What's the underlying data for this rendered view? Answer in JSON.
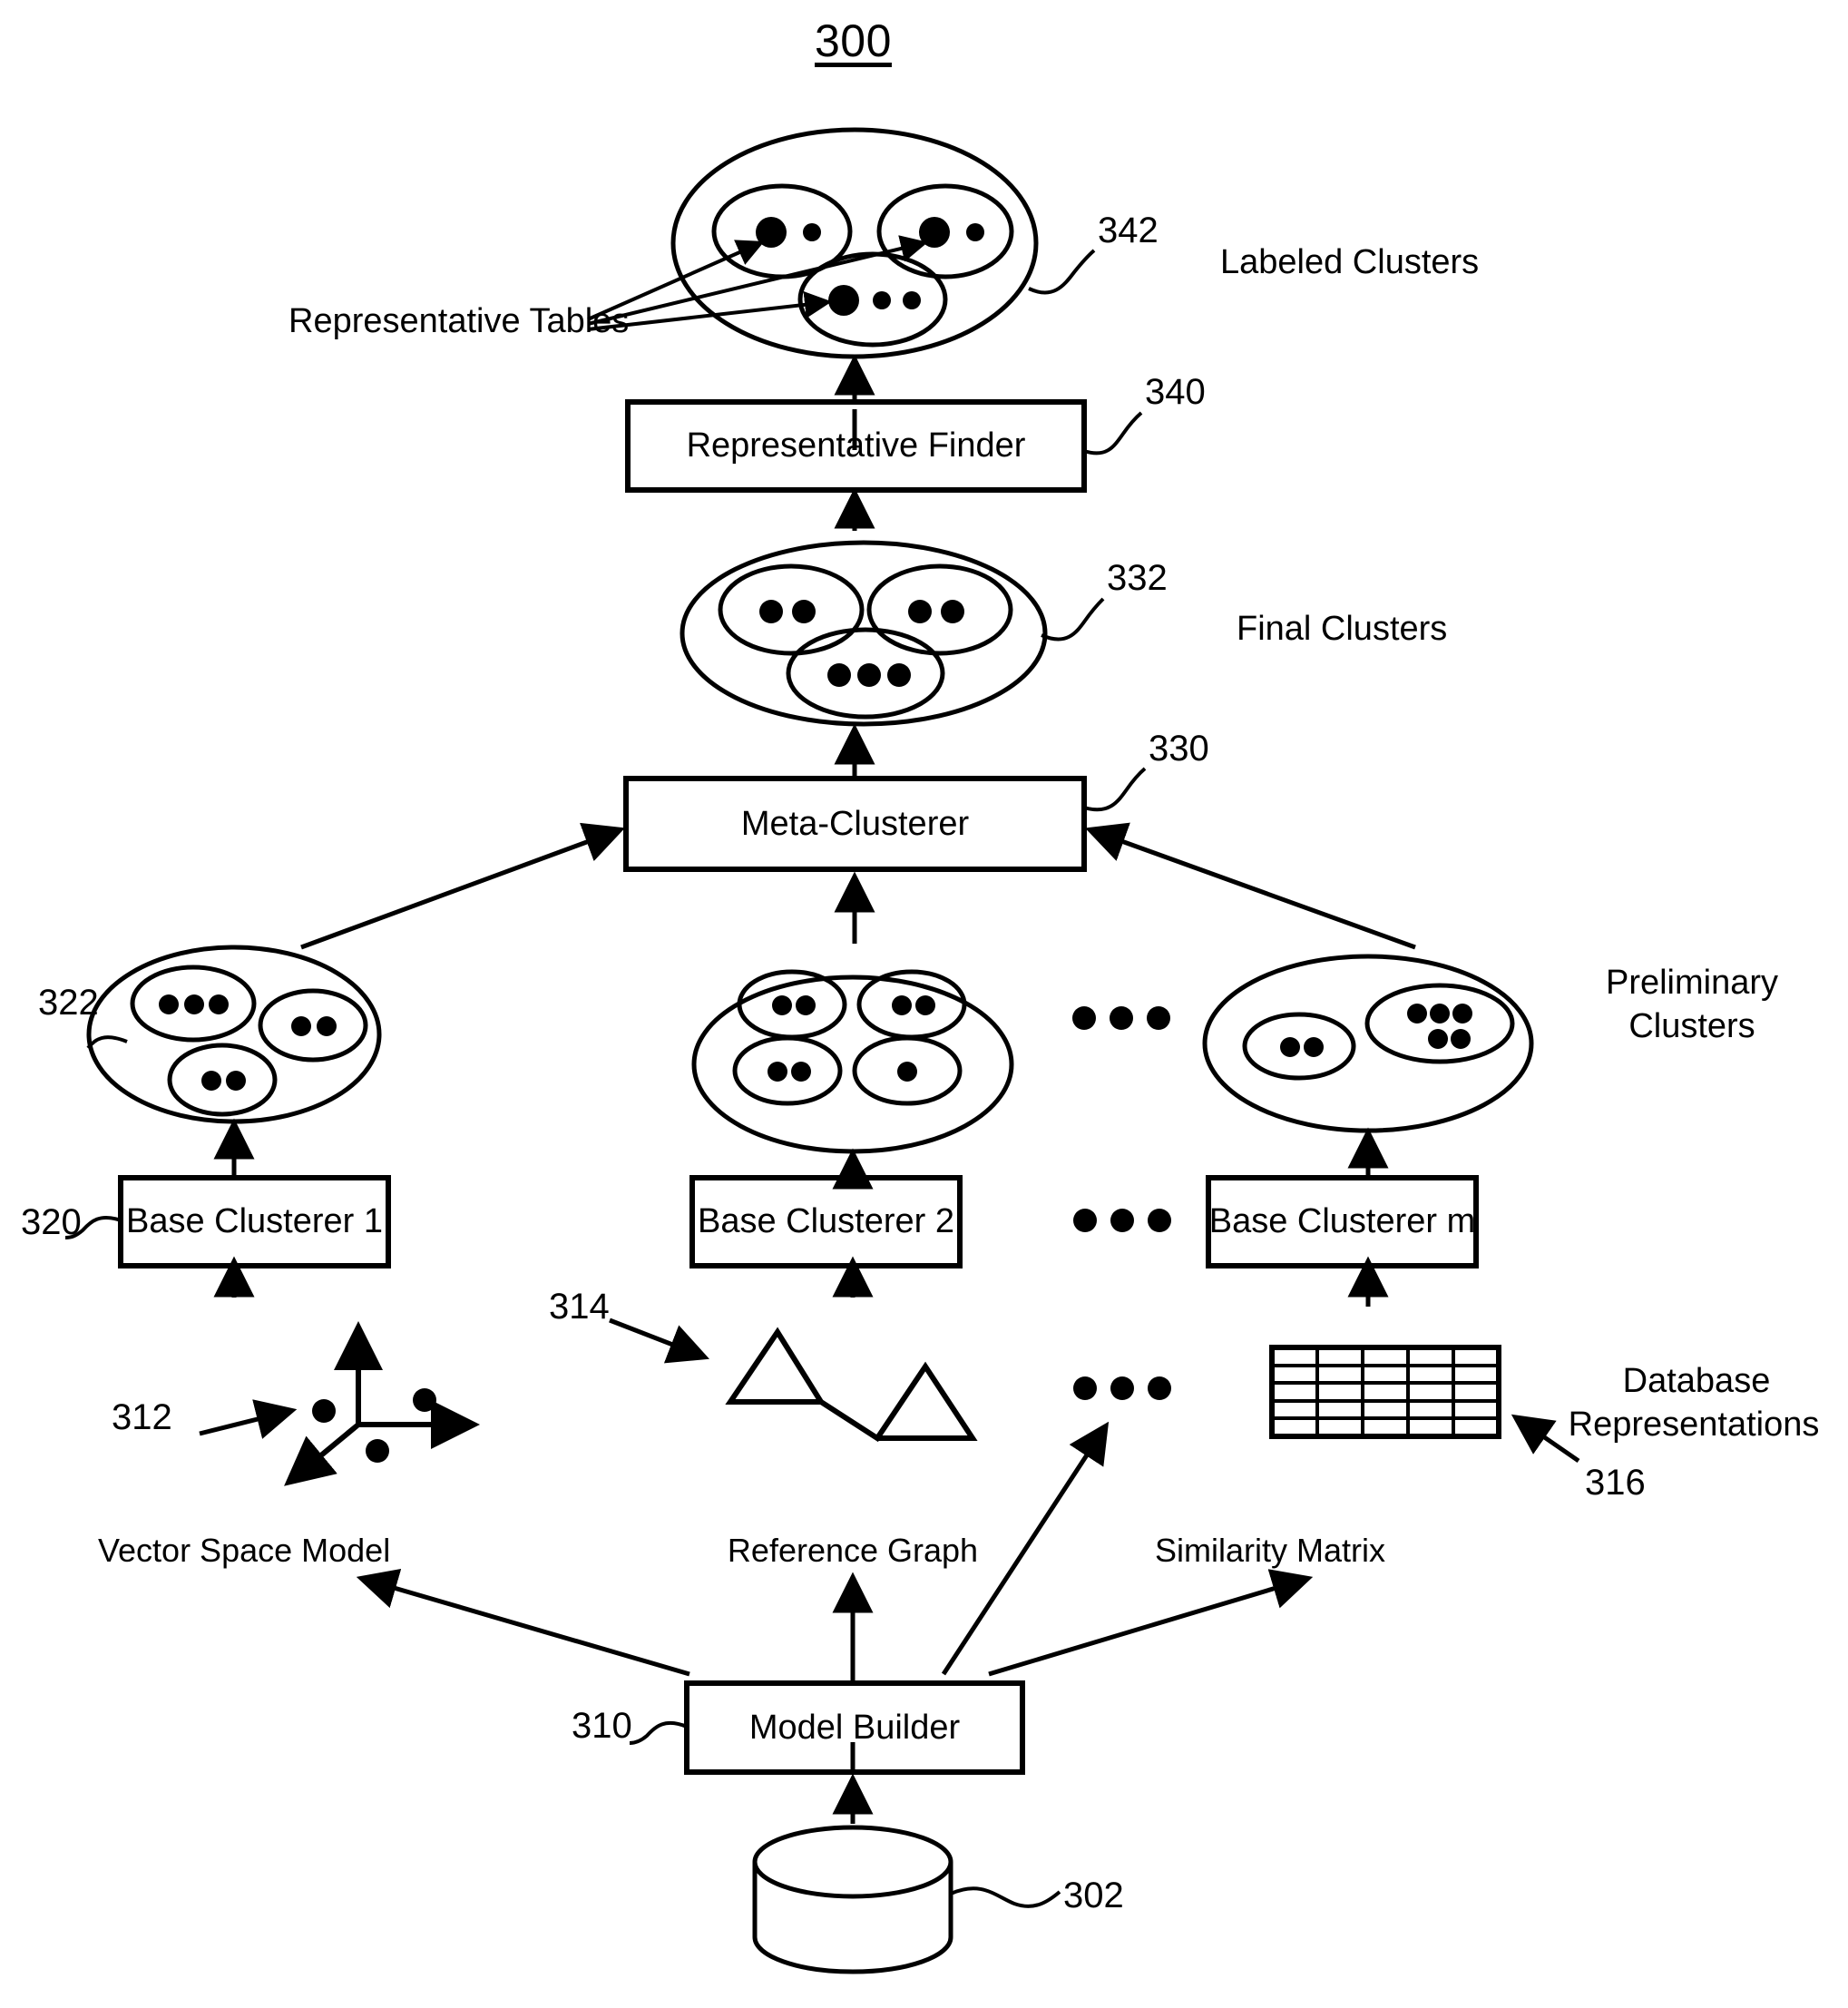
{
  "figure": {
    "number": "300",
    "kind": "patent-flow-diagram"
  },
  "reference_numerals": {
    "n342": "342",
    "n340": "340",
    "n332": "332",
    "n330": "330",
    "n322": "322",
    "n320": "320",
    "n312": "312",
    "n314": "314",
    "n316": "316",
    "n310": "310",
    "n302": "302"
  },
  "boxes": {
    "representative_finder": "Representative Finder",
    "meta_clusterer": "Meta-Clusterer",
    "base_clusterer_1": "Base Clusterer 1",
    "base_clusterer_2": "Base Clusterer 2",
    "base_clusterer_m": "Base Clusterer m",
    "model_builder": "Model Builder"
  },
  "side_labels": {
    "labeled_clusters": "Labeled Clusters",
    "final_clusters": "Final Clusters",
    "preliminary_clusters_line1": "Preliminary",
    "preliminary_clusters_line2": "Clusters",
    "database_representations_line1": "Database",
    "database_representations_line2": "Representations"
  },
  "leader_labels": {
    "representative_tables": "Representative Tables"
  },
  "model_labels": {
    "vector_space_model": "Vector Space Model",
    "reference_graph": "Reference Graph",
    "similarity_matrix": "Similarity Matrix"
  },
  "icons": {
    "database": "database-cylinder-icon",
    "axes": "3d-axes-icon",
    "graph": "triangle-graph-icon",
    "matrix": "grid-matrix-icon",
    "ellipsis": "horizontal-ellipsis-icon"
  },
  "chart_data": {
    "type": "diagram",
    "title": "300",
    "nodes": [
      {
        "id": "302",
        "label": "",
        "shape": "cylinder",
        "role": "database"
      },
      {
        "id": "310",
        "label": "Model Builder",
        "shape": "rect"
      },
      {
        "id": "312",
        "label": "Vector Space Model",
        "shape": "3d-axes",
        "points": 3
      },
      {
        "id": "314",
        "label": "Reference Graph",
        "shape": "triangles",
        "triangles": 2
      },
      {
        "id": "316",
        "label": "Similarity Matrix",
        "shape": "grid",
        "rows": 5,
        "cols": 5
      },
      {
        "id": "320a",
        "label": "Base Clusterer 1",
        "shape": "rect"
      },
      {
        "id": "320b",
        "label": "Base Clusterer 2",
        "shape": "rect"
      },
      {
        "id": "320c",
        "label": "Base Clusterer m",
        "shape": "rect"
      },
      {
        "id": "322a",
        "label": "Preliminary Clusters",
        "shape": "ellipse",
        "subclusters": [
          3,
          2,
          2
        ]
      },
      {
        "id": "322b",
        "label": "Preliminary Clusters",
        "shape": "ellipse",
        "subclusters": [
          2,
          2,
          2,
          1
        ]
      },
      {
        "id": "322c",
        "label": "Preliminary Clusters",
        "shape": "ellipse",
        "subclusters": [
          2,
          5
        ]
      },
      {
        "id": "330",
        "label": "Meta-Clusterer",
        "shape": "rect"
      },
      {
        "id": "332",
        "label": "Final Clusters",
        "shape": "ellipse",
        "subclusters": [
          2,
          2,
          3
        ]
      },
      {
        "id": "340",
        "label": "Representative Finder",
        "shape": "rect"
      },
      {
        "id": "342",
        "label": "Labeled Clusters",
        "shape": "ellipse",
        "subclusters": [
          2,
          2,
          3
        ],
        "representatives": 3
      }
    ],
    "edges": [
      {
        "from": "302",
        "to": "310"
      },
      {
        "from": "310",
        "to": "312"
      },
      {
        "from": "310",
        "to": "314"
      },
      {
        "from": "310",
        "to": "316"
      },
      {
        "from": "312",
        "to": "320a"
      },
      {
        "from": "314",
        "to": "320b"
      },
      {
        "from": "316",
        "to": "320c"
      },
      {
        "from": "320a",
        "to": "322a"
      },
      {
        "from": "320b",
        "to": "322b"
      },
      {
        "from": "320c",
        "to": "322c"
      },
      {
        "from": "322a",
        "to": "330"
      },
      {
        "from": "322b",
        "to": "330"
      },
      {
        "from": "322c",
        "to": "330"
      },
      {
        "from": "330",
        "to": "332"
      },
      {
        "from": "332",
        "to": "340"
      },
      {
        "from": "340",
        "to": "342"
      }
    ]
  }
}
